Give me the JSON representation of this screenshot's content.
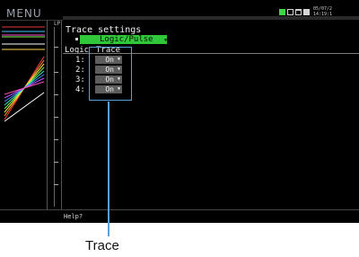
{
  "screen": {
    "menu_label": "MENU",
    "scale_label": "LP",
    "status_icons": [
      "battery-icon",
      "memory-card-icon",
      "display-icon",
      "key-lock-icon"
    ],
    "date": "05/07/2",
    "time": "14:19:1"
  },
  "settings": {
    "title": "Trace settings",
    "mode_value": "Logic/Pulse",
    "columns": {
      "logic": "Logic",
      "trace": "Trace"
    },
    "rows": [
      {
        "label": "1:",
        "value": "On"
      },
      {
        "label": "2:",
        "value": "On"
      },
      {
        "label": "3:",
        "value": "On"
      },
      {
        "label": "4:",
        "value": "On"
      }
    ],
    "help": "Help?"
  },
  "annotation": {
    "callout": "Trace"
  },
  "colors": {
    "background": "#000000",
    "accent_green": "#31c73a",
    "highlight_blue": "#5aa0d8",
    "field_grey": "#5d5d5d"
  }
}
